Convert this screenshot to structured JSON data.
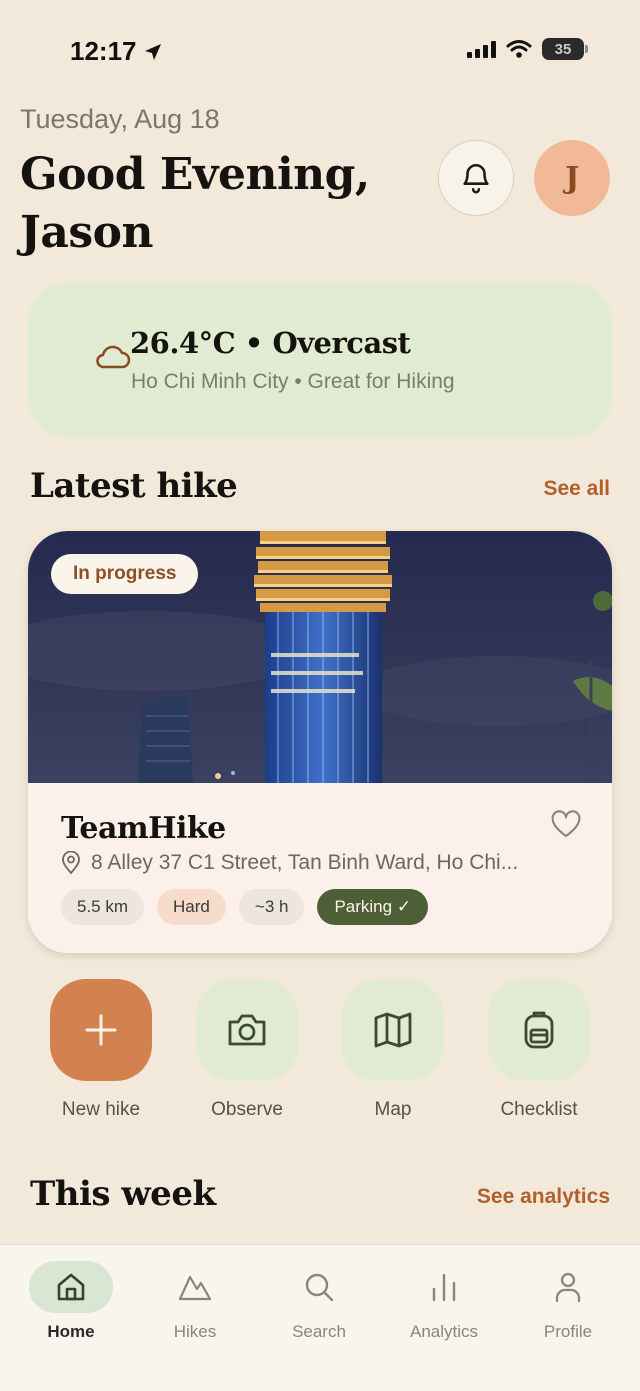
{
  "status_bar": {
    "time": "12:17",
    "battery": "35"
  },
  "header": {
    "date": "Tuesday, Aug 18",
    "greeting": "Good Evening, Jason",
    "avatar_initial": "J"
  },
  "weather": {
    "title": "26.4°C • Overcast",
    "subtitle": "Ho Chi Minh City • Great for Hiking",
    "icon": "cloud-icon"
  },
  "latest_hike_section": {
    "title": "Latest hike",
    "link": "See all"
  },
  "hike_card": {
    "status": "In progress",
    "name": "TeamHike",
    "address": "8 Alley 37 C1 Street, Tan Binh Ward, Ho Chi...",
    "chips": {
      "distance": "5.5 km",
      "difficulty": "Hard",
      "duration": "~3 h",
      "parking": "Parking ✓"
    }
  },
  "quick_actions": [
    {
      "label": "New hike",
      "icon": "plus-icon"
    },
    {
      "label": "Observe",
      "icon": "camera-icon"
    },
    {
      "label": "Map",
      "icon": "map-icon"
    },
    {
      "label": "Checklist",
      "icon": "backpack-icon"
    }
  ],
  "this_week_section": {
    "title": "This week",
    "link": "See analytics"
  },
  "tabs": [
    {
      "label": "Home",
      "icon": "home-icon",
      "active": true
    },
    {
      "label": "Hikes",
      "icon": "mountain-icon"
    },
    {
      "label": "Search",
      "icon": "search-icon"
    },
    {
      "label": "Analytics",
      "icon": "bar-chart-icon"
    },
    {
      "label": "Profile",
      "icon": "person-icon"
    }
  ],
  "colors": {
    "background": "#f3e9da",
    "accent": "#b35f2c",
    "primary_action": "#d2814f",
    "weather_card": "#e1ebd1",
    "parking_chip": "#4d5f36"
  }
}
